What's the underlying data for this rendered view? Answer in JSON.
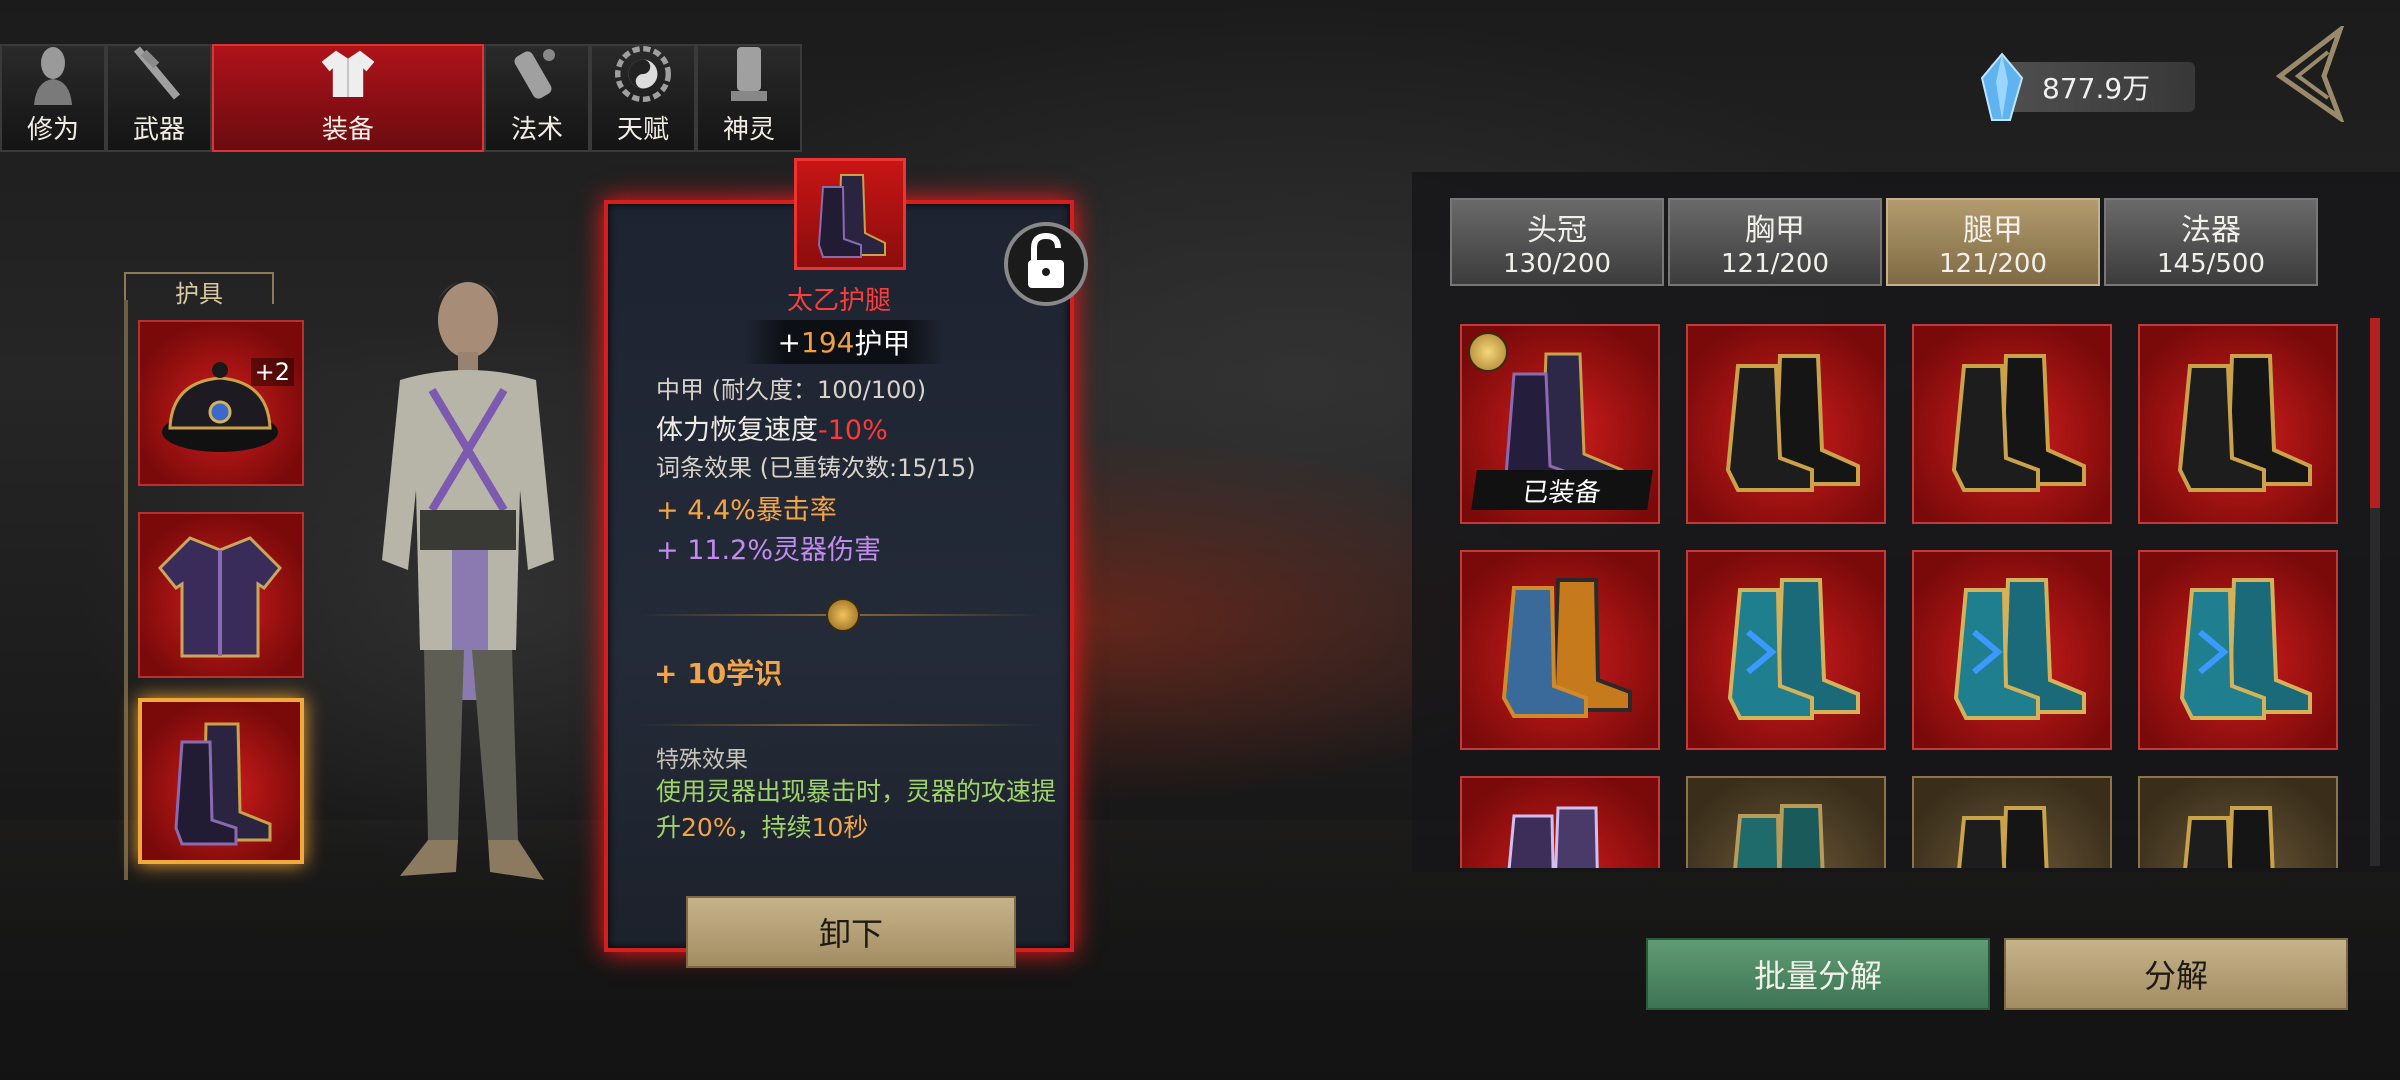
{
  "top_tabs": [
    {
      "label": "修为",
      "icon": "meditation-head-icon",
      "active": false
    },
    {
      "label": "武器",
      "icon": "sword-icon",
      "active": false
    },
    {
      "label": "装备",
      "icon": "robe-icon",
      "active": true
    },
    {
      "label": "法术",
      "icon": "scroll-icon",
      "active": false
    },
    {
      "label": "天赋",
      "icon": "bagua-icon",
      "active": false
    },
    {
      "label": "神灵",
      "icon": "tablet-icon",
      "active": false
    }
  ],
  "currency": {
    "value": "877.9万",
    "icon": "crystal-icon"
  },
  "armor_section": {
    "title": "护具",
    "slots": [
      {
        "name": "hat",
        "enhance": "+2"
      },
      {
        "name": "chest"
      },
      {
        "name": "boots",
        "selected": true
      }
    ]
  },
  "tooltip": {
    "name": "太乙护腿",
    "armor_prefix": "+",
    "armor_value": "194",
    "armor_label": "护甲",
    "type_line": "中甲 (耐久度：100/100)",
    "stamina_label": "体力恢复速度",
    "stamina_value": "-10%",
    "affix_title": "词条效果 (已重铸次数:15/15)",
    "affix1_value": "+ 4.4%",
    "affix1_label": "暴击率",
    "affix2_value": "+ 11.2%",
    "affix2_label": "灵器伤害",
    "scholar": "+ 10学识",
    "special_title": "特殊效果",
    "special_text_a": "使用灵器出现暴击时，灵器的攻速提升",
    "special_pct": "20%",
    "special_text_b": "，持续",
    "special_dur": "10秒",
    "unequip_label": "卸下"
  },
  "categories": [
    {
      "label": "头冠",
      "count": "130/200",
      "active": false
    },
    {
      "label": "胸甲",
      "count": "121/200",
      "active": false
    },
    {
      "label": "腿甲",
      "count": "121/200",
      "active": true
    },
    {
      "label": "法器",
      "count": "145/500",
      "active": false
    }
  ],
  "grid": {
    "equipped_label": "已装备",
    "items": [
      {
        "style": "purple-boots",
        "equipped": true
      },
      {
        "style": "black-gold-boots"
      },
      {
        "style": "black-gold-boots"
      },
      {
        "style": "black-gold-boots"
      },
      {
        "style": "orange-boots"
      },
      {
        "style": "teal-boots"
      },
      {
        "style": "teal-boots"
      },
      {
        "style": "teal-boots"
      },
      {
        "style": "purple-embroidered-boots"
      },
      {
        "style": "teal-boots",
        "tier": "brown"
      },
      {
        "style": "black-gold-boots",
        "tier": "brown"
      },
      {
        "style": "black-gold-boots",
        "tier": "brown"
      }
    ]
  },
  "buttons": {
    "batch_decompose": "批量分解",
    "decompose": "分解"
  },
  "colors": {
    "accent_red": "#d41f1f",
    "active_tab": "#b0121a",
    "gold": "#f3a447",
    "purple": "#c38af0",
    "green_text": "#9fd46a"
  }
}
